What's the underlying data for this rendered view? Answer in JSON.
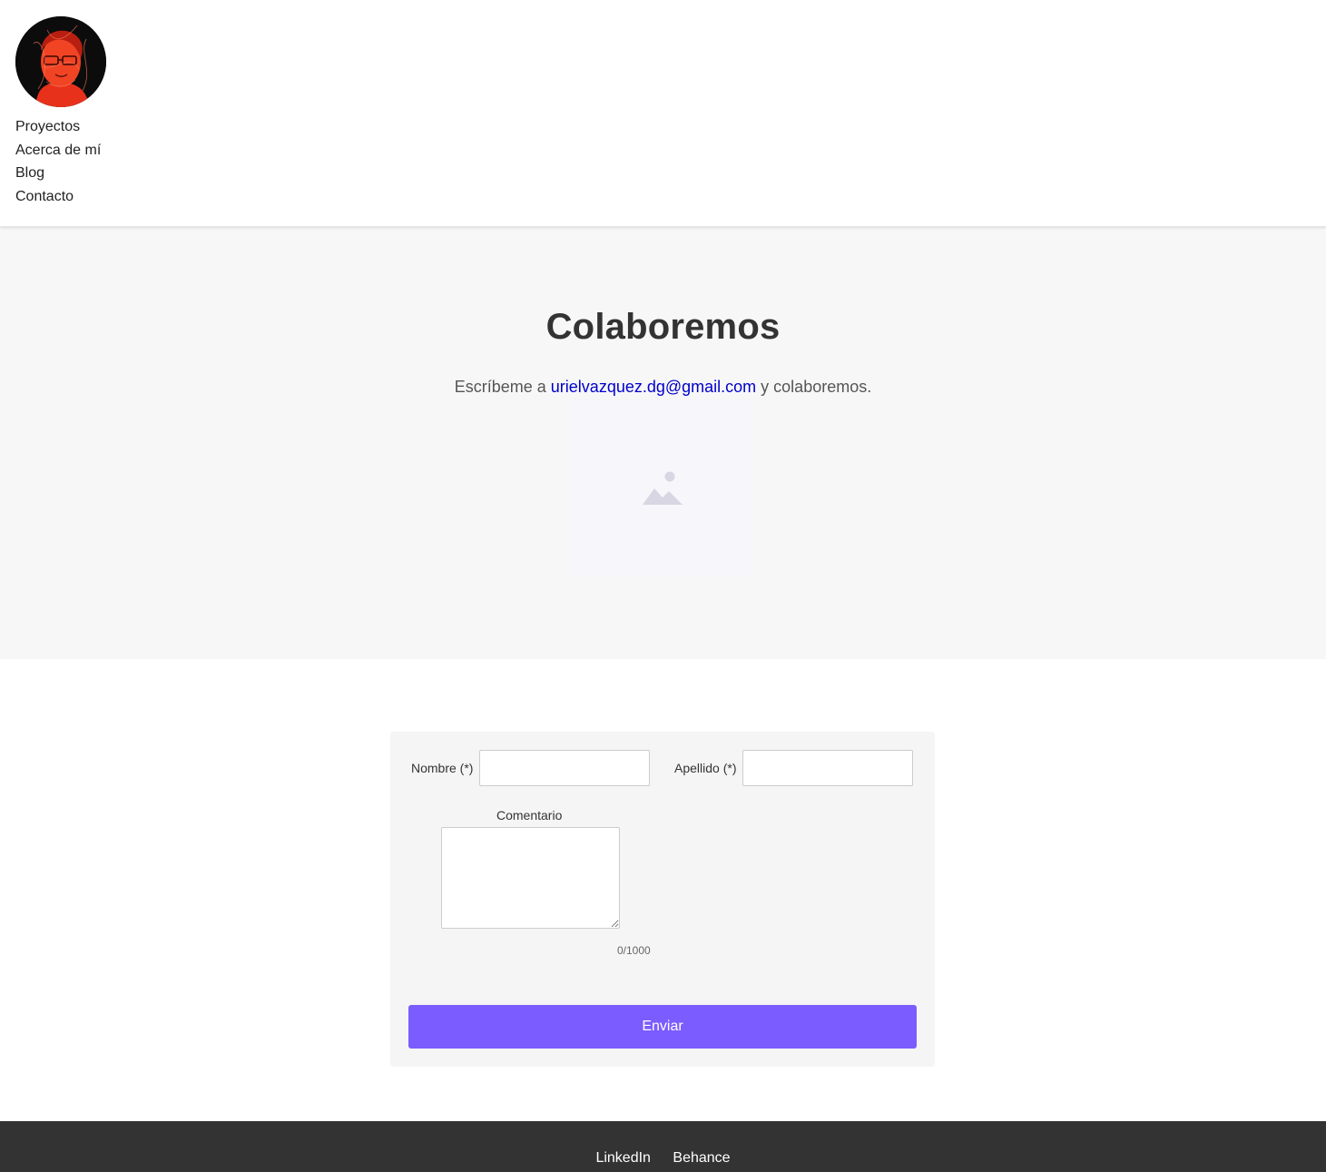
{
  "header": {
    "nav": [
      {
        "label": "Proyectos"
      },
      {
        "label": "Acerca de mí"
      },
      {
        "label": "Blog"
      },
      {
        "label": "Contacto"
      }
    ]
  },
  "hero": {
    "title": "Colaboremos",
    "text_before": "Escríbeme a ",
    "email": "urielvazquez.dg@gmail.com",
    "text_after": " y colaboremos.",
    "placeholder_icon": "image-placeholder-icon"
  },
  "form": {
    "first_name_label": "Nombre (*)",
    "last_name_label": "Apellido (*)",
    "comment_label": "Comentario",
    "counter": "0/1000",
    "submit_label": "Enviar",
    "accent_color": "#7b5cff"
  },
  "footer": {
    "links": [
      {
        "label": "LinkedIn"
      },
      {
        "label": "Behance"
      }
    ]
  }
}
